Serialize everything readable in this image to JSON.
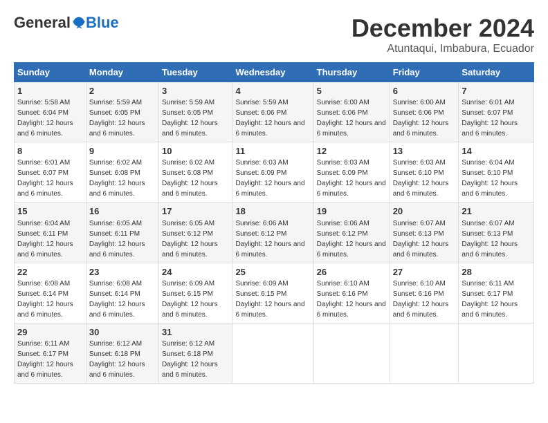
{
  "logo": {
    "general": "General",
    "blue": "Blue"
  },
  "title": "December 2024",
  "subtitle": "Atuntaqui, Imbabura, Ecuador",
  "days_of_week": [
    "Sunday",
    "Monday",
    "Tuesday",
    "Wednesday",
    "Thursday",
    "Friday",
    "Saturday"
  ],
  "weeks": [
    [
      {
        "day": "1",
        "sunrise": "5:58 AM",
        "sunset": "6:04 PM",
        "daylight": "12 hours and 6 minutes."
      },
      {
        "day": "2",
        "sunrise": "5:59 AM",
        "sunset": "6:05 PM",
        "daylight": "12 hours and 6 minutes."
      },
      {
        "day": "3",
        "sunrise": "5:59 AM",
        "sunset": "6:05 PM",
        "daylight": "12 hours and 6 minutes."
      },
      {
        "day": "4",
        "sunrise": "5:59 AM",
        "sunset": "6:06 PM",
        "daylight": "12 hours and 6 minutes."
      },
      {
        "day": "5",
        "sunrise": "6:00 AM",
        "sunset": "6:06 PM",
        "daylight": "12 hours and 6 minutes."
      },
      {
        "day": "6",
        "sunrise": "6:00 AM",
        "sunset": "6:06 PM",
        "daylight": "12 hours and 6 minutes."
      },
      {
        "day": "7",
        "sunrise": "6:01 AM",
        "sunset": "6:07 PM",
        "daylight": "12 hours and 6 minutes."
      }
    ],
    [
      {
        "day": "8",
        "sunrise": "6:01 AM",
        "sunset": "6:07 PM",
        "daylight": "12 hours and 6 minutes."
      },
      {
        "day": "9",
        "sunrise": "6:02 AM",
        "sunset": "6:08 PM",
        "daylight": "12 hours and 6 minutes."
      },
      {
        "day": "10",
        "sunrise": "6:02 AM",
        "sunset": "6:08 PM",
        "daylight": "12 hours and 6 minutes."
      },
      {
        "day": "11",
        "sunrise": "6:03 AM",
        "sunset": "6:09 PM",
        "daylight": "12 hours and 6 minutes."
      },
      {
        "day": "12",
        "sunrise": "6:03 AM",
        "sunset": "6:09 PM",
        "daylight": "12 hours and 6 minutes."
      },
      {
        "day": "13",
        "sunrise": "6:03 AM",
        "sunset": "6:10 PM",
        "daylight": "12 hours and 6 minutes."
      },
      {
        "day": "14",
        "sunrise": "6:04 AM",
        "sunset": "6:10 PM",
        "daylight": "12 hours and 6 minutes."
      }
    ],
    [
      {
        "day": "15",
        "sunrise": "6:04 AM",
        "sunset": "6:11 PM",
        "daylight": "12 hours and 6 minutes."
      },
      {
        "day": "16",
        "sunrise": "6:05 AM",
        "sunset": "6:11 PM",
        "daylight": "12 hours and 6 minutes."
      },
      {
        "day": "17",
        "sunrise": "6:05 AM",
        "sunset": "6:12 PM",
        "daylight": "12 hours and 6 minutes."
      },
      {
        "day": "18",
        "sunrise": "6:06 AM",
        "sunset": "6:12 PM",
        "daylight": "12 hours and 6 minutes."
      },
      {
        "day": "19",
        "sunrise": "6:06 AM",
        "sunset": "6:12 PM",
        "daylight": "12 hours and 6 minutes."
      },
      {
        "day": "20",
        "sunrise": "6:07 AM",
        "sunset": "6:13 PM",
        "daylight": "12 hours and 6 minutes."
      },
      {
        "day": "21",
        "sunrise": "6:07 AM",
        "sunset": "6:13 PM",
        "daylight": "12 hours and 6 minutes."
      }
    ],
    [
      {
        "day": "22",
        "sunrise": "6:08 AM",
        "sunset": "6:14 PM",
        "daylight": "12 hours and 6 minutes."
      },
      {
        "day": "23",
        "sunrise": "6:08 AM",
        "sunset": "6:14 PM",
        "daylight": "12 hours and 6 minutes."
      },
      {
        "day": "24",
        "sunrise": "6:09 AM",
        "sunset": "6:15 PM",
        "daylight": "12 hours and 6 minutes."
      },
      {
        "day": "25",
        "sunrise": "6:09 AM",
        "sunset": "6:15 PM",
        "daylight": "12 hours and 6 minutes."
      },
      {
        "day": "26",
        "sunrise": "6:10 AM",
        "sunset": "6:16 PM",
        "daylight": "12 hours and 6 minutes."
      },
      {
        "day": "27",
        "sunrise": "6:10 AM",
        "sunset": "6:16 PM",
        "daylight": "12 hours and 6 minutes."
      },
      {
        "day": "28",
        "sunrise": "6:11 AM",
        "sunset": "6:17 PM",
        "daylight": "12 hours and 6 minutes."
      }
    ],
    [
      {
        "day": "29",
        "sunrise": "6:11 AM",
        "sunset": "6:17 PM",
        "daylight": "12 hours and 6 minutes."
      },
      {
        "day": "30",
        "sunrise": "6:12 AM",
        "sunset": "6:18 PM",
        "daylight": "12 hours and 6 minutes."
      },
      {
        "day": "31",
        "sunrise": "6:12 AM",
        "sunset": "6:18 PM",
        "daylight": "12 hours and 6 minutes."
      },
      null,
      null,
      null,
      null
    ]
  ]
}
